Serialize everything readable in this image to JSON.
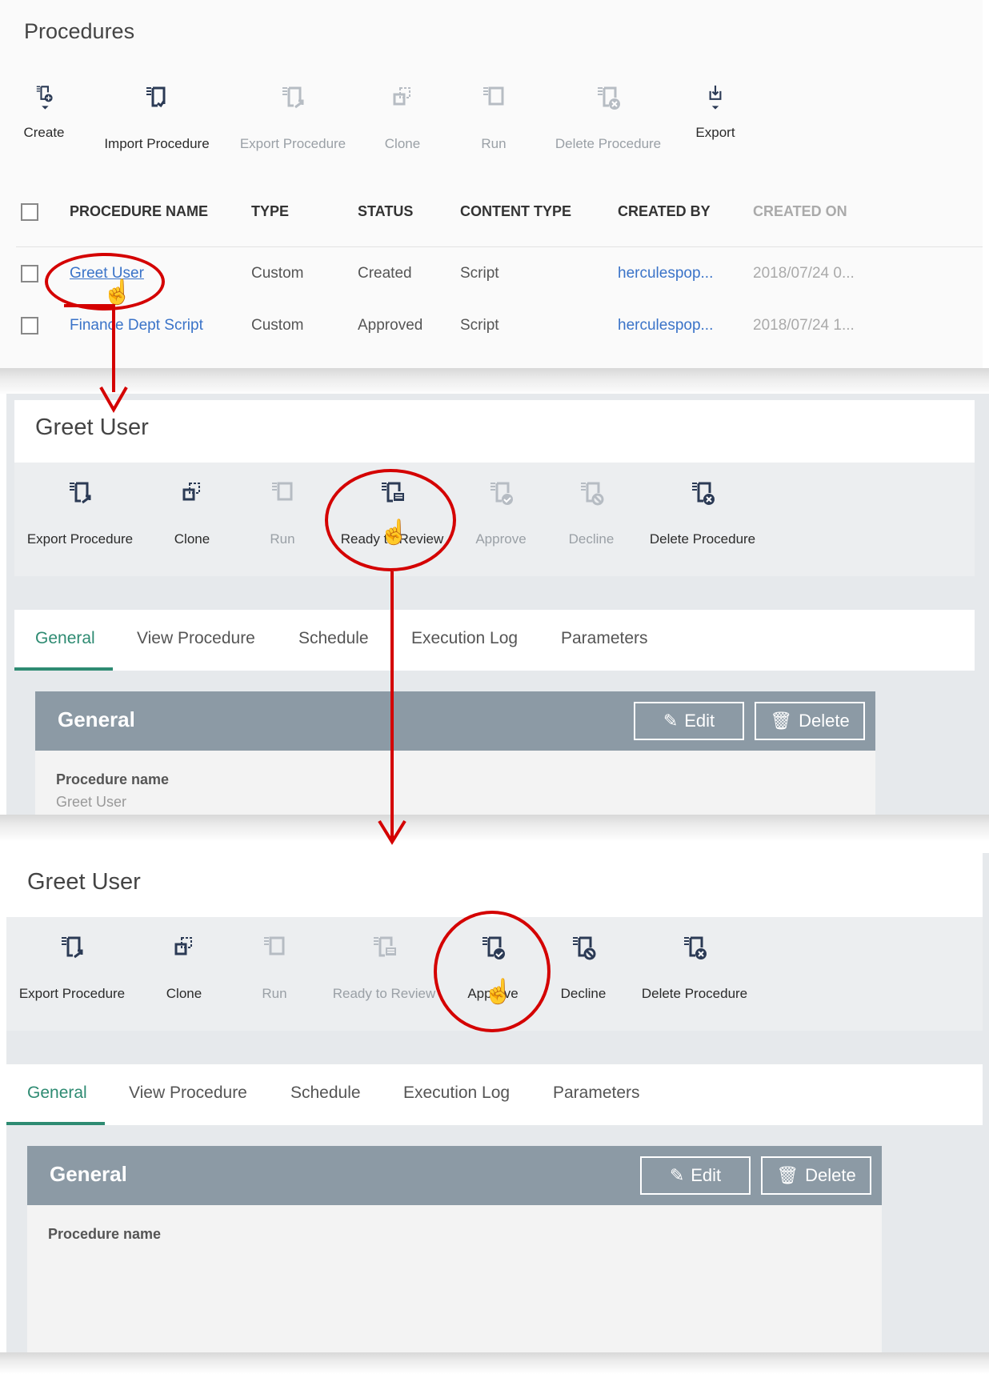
{
  "procedures": {
    "title": "Procedures",
    "toolbar": [
      {
        "label": "Create",
        "icon": "create-procedure-icon",
        "enabled": true
      },
      {
        "label": "Import Procedure",
        "icon": "import-procedure-icon",
        "enabled": true
      },
      {
        "label": "Export Procedure",
        "icon": "export-procedure-icon",
        "enabled": false
      },
      {
        "label": "Clone",
        "icon": "clone-icon",
        "enabled": false
      },
      {
        "label": "Run",
        "icon": "run-icon",
        "enabled": false
      },
      {
        "label": "Delete Procedure",
        "icon": "delete-procedure-icon",
        "enabled": false
      },
      {
        "label": "Export",
        "icon": "export-icon",
        "enabled": true
      }
    ],
    "columns": [
      "PROCEDURE NAME",
      "TYPE",
      "STATUS",
      "CONTENT TYPE",
      "CREATED BY",
      "CREATED ON"
    ],
    "rows": [
      {
        "name": "Greet User",
        "type": "Custom",
        "status": "Created",
        "content_type": "Script",
        "created_by": "herculespop...",
        "created_on": "2018/07/24 0..."
      },
      {
        "name": "Finance Dept Script",
        "type": "Custom",
        "status": "Approved",
        "content_type": "Script",
        "created_by": "herculespop...",
        "created_on": "2018/07/24 1..."
      }
    ]
  },
  "detail1": {
    "title": "Greet User",
    "toolbar": [
      {
        "label": "Export Procedure",
        "icon": "export-procedure-icon",
        "enabled": true
      },
      {
        "label": "Clone",
        "icon": "clone-icon",
        "enabled": true
      },
      {
        "label": "Run",
        "icon": "run-icon",
        "enabled": false
      },
      {
        "label": "Ready to Review",
        "icon": "ready-to-review-icon",
        "enabled": true
      },
      {
        "label": "Approve",
        "icon": "approve-icon",
        "enabled": false
      },
      {
        "label": "Decline",
        "icon": "decline-icon",
        "enabled": false
      },
      {
        "label": "Delete Procedure",
        "icon": "delete-procedure-icon",
        "enabled": true
      }
    ],
    "tabs": [
      "General",
      "View Procedure",
      "Schedule",
      "Execution Log",
      "Parameters"
    ],
    "section_title": "General",
    "edit_label": "Edit",
    "delete_label": "Delete",
    "field_label": "Procedure name",
    "field_value": "Greet User"
  },
  "detail2": {
    "title": "Greet User",
    "toolbar": [
      {
        "label": "Export Procedure",
        "icon": "export-procedure-icon",
        "enabled": true
      },
      {
        "label": "Clone",
        "icon": "clone-icon",
        "enabled": true
      },
      {
        "label": "Run",
        "icon": "run-icon",
        "enabled": false
      },
      {
        "label": "Ready to Review",
        "icon": "ready-to-review-icon",
        "enabled": false
      },
      {
        "label": "Approve",
        "icon": "approve-icon",
        "enabled": true
      },
      {
        "label": "Decline",
        "icon": "decline-icon",
        "enabled": true
      },
      {
        "label": "Delete Procedure",
        "icon": "delete-procedure-icon",
        "enabled": true
      }
    ],
    "tabs": [
      "General",
      "View Procedure",
      "Schedule",
      "Execution Log",
      "Parameters"
    ],
    "section_title": "General",
    "edit_label": "Edit",
    "delete_label": "Delete",
    "field_label": "Procedure name"
  },
  "colors": {
    "accent": "#2e8b72",
    "link": "#3a73c8",
    "annotation": "#d40000",
    "section_header": "#8c9aa5"
  }
}
